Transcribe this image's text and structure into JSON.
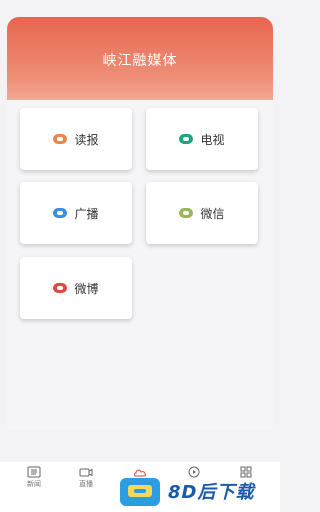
{
  "header": {
    "title": "峡江融媒体"
  },
  "cards": [
    {
      "label": "读报",
      "icon": "newspaper-icon",
      "color": "#e7874b"
    },
    {
      "label": "电视",
      "icon": "tv-icon",
      "color": "#1fa37f"
    },
    {
      "label": "广播",
      "icon": "radio-icon",
      "color": "#3a8fe0"
    },
    {
      "label": "微信",
      "icon": "wechat-icon",
      "color": "#97b85a"
    },
    {
      "label": "微博",
      "icon": "weibo-icon",
      "color": "#e14a42"
    }
  ],
  "tabbar": {
    "items": [
      {
        "label": "新闻",
        "icon": "news-icon"
      },
      {
        "label": "直播",
        "icon": "camera-icon"
      },
      {
        "label": "",
        "icon": "cloud-icon"
      },
      {
        "label": "",
        "icon": "play-icon"
      },
      {
        "label": "",
        "icon": "grid-icon"
      }
    ]
  },
  "watermark": {
    "text": "8D后下载"
  },
  "colors": {
    "header_start": "#e7664f",
    "header_end": "#f7c7bb",
    "active_tab": "#e7664f"
  }
}
